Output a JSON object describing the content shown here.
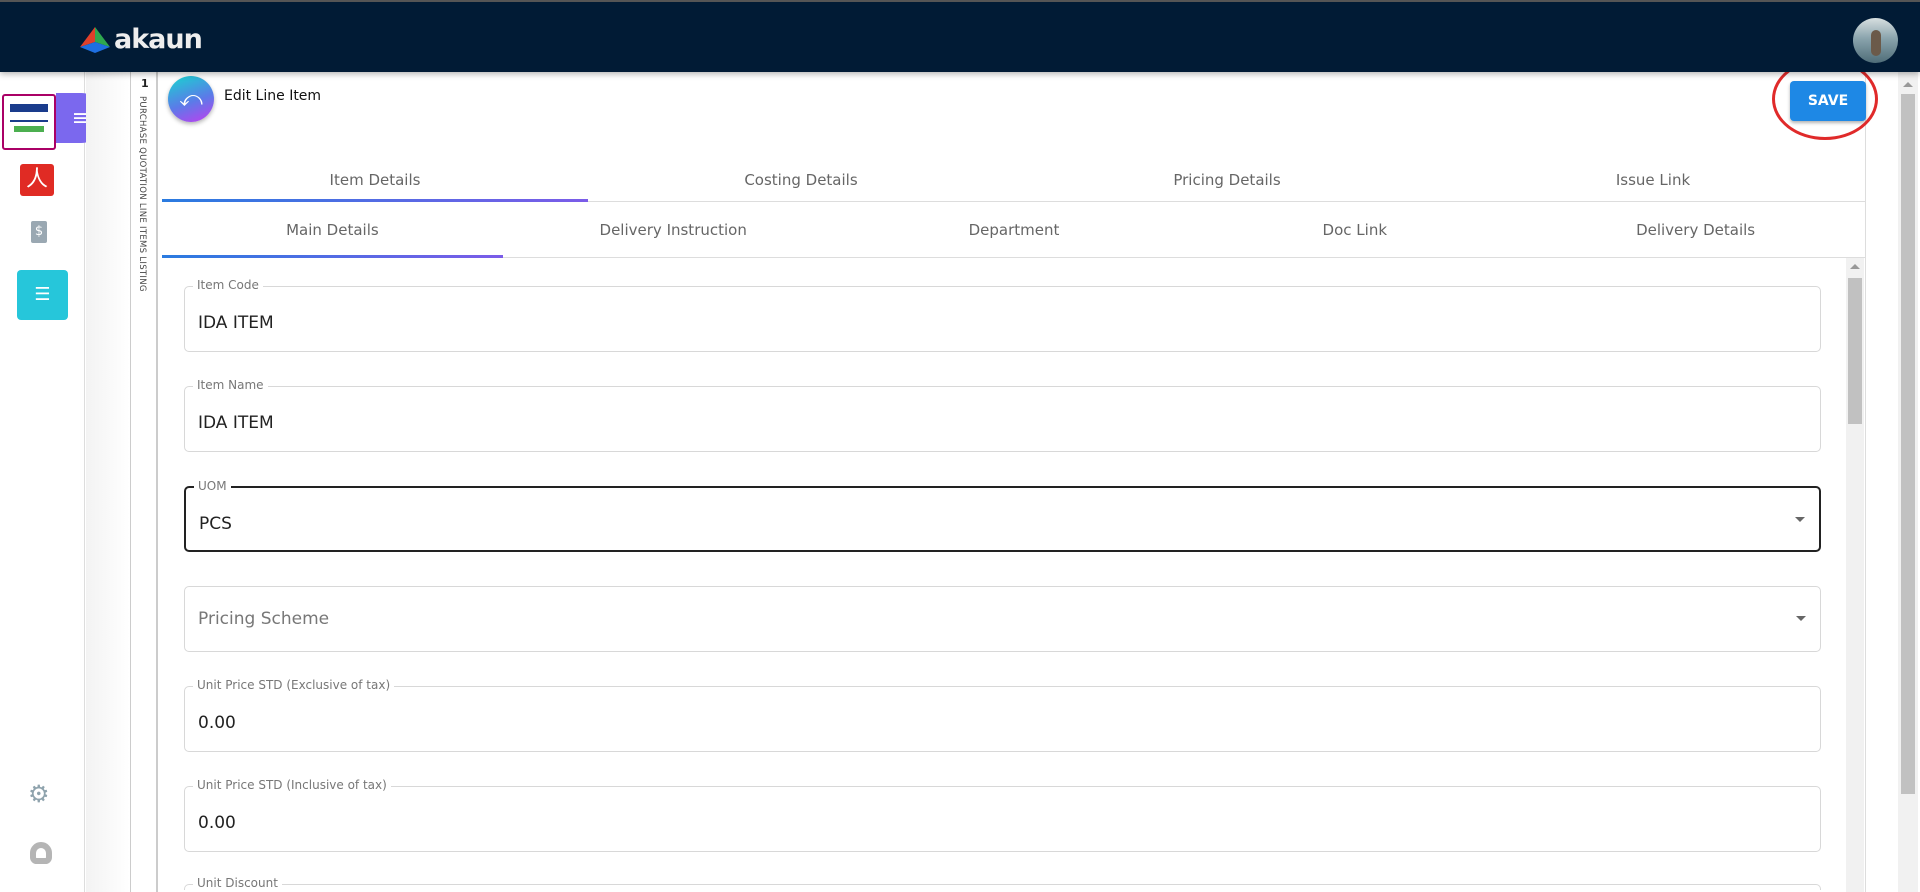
{
  "header": {
    "logo_text": "akaun"
  },
  "side_panel": {
    "count": "1",
    "vertical_label": "PURCHASE QUOTATION LINE ITEMS LISTING"
  },
  "page": {
    "title": "Edit Line Item",
    "save_label": "SAVE"
  },
  "tabs_primary": [
    {
      "label": "Item Details",
      "active": true
    },
    {
      "label": "Costing Details"
    },
    {
      "label": "Pricing Details"
    },
    {
      "label": "Issue Link"
    }
  ],
  "tabs_secondary": [
    {
      "label": "Main Details",
      "active": true
    },
    {
      "label": "Delivery Instruction"
    },
    {
      "label": "Department"
    },
    {
      "label": "Doc Link"
    },
    {
      "label": "Delivery Details"
    }
  ],
  "form": {
    "item_code": {
      "label": "Item Code",
      "value": "IDA ITEM"
    },
    "item_name": {
      "label": "Item Name",
      "value": "IDA ITEM"
    },
    "uom": {
      "label": "UOM",
      "value": "PCS"
    },
    "pricing_scheme": {
      "placeholder": "Pricing Scheme"
    },
    "unit_price_excl": {
      "label": "Unit Price STD (Exclusive of tax)",
      "value": "0.00"
    },
    "unit_price_incl": {
      "label": "Unit Price STD (Inclusive of tax)",
      "value": "0.00"
    },
    "unit_discount": {
      "label": "Unit Discount"
    }
  },
  "colors": {
    "header": "#011b35",
    "save": "#1e88e5",
    "highlight_ring": "#e02a2a",
    "active_app": "#26c6da"
  }
}
